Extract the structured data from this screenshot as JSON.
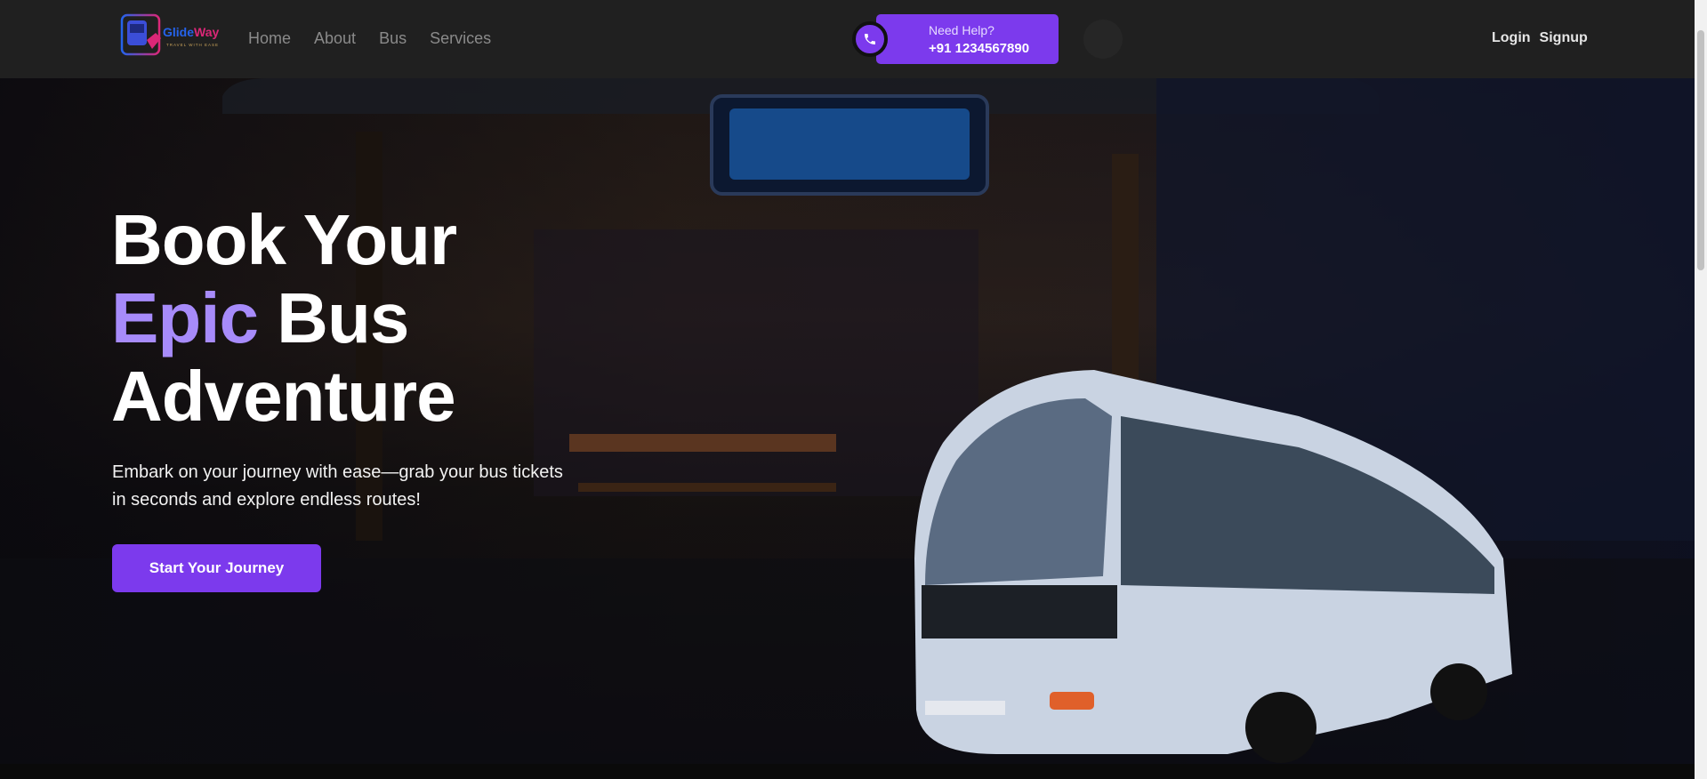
{
  "brand": {
    "name_part1": "Glide",
    "name_part2": "Way",
    "tagline": "TRAVEL WITH EASE"
  },
  "nav": {
    "items": [
      {
        "label": "Home"
      },
      {
        "label": "About"
      },
      {
        "label": "Bus"
      },
      {
        "label": "Services"
      }
    ]
  },
  "help": {
    "title": "Need Help?",
    "phone": "+91 1234567890",
    "icon": "phone-icon"
  },
  "theme_toggle": {
    "icon": "moon-icon"
  },
  "auth": {
    "login": "Login",
    "signup": "Signup"
  },
  "hero": {
    "title_line1": "Book Your",
    "title_accent": "Epic",
    "title_line2_rest": " Bus",
    "title_line3": "Adventure",
    "description": "Embark on your journey with ease—grab your bus tickets in seconds and explore endless routes!",
    "cta": "Start Your Journey"
  },
  "colors": {
    "accent": "#7c3aed",
    "accent_text": "#a78bfa",
    "nav_bg": "#202020"
  }
}
